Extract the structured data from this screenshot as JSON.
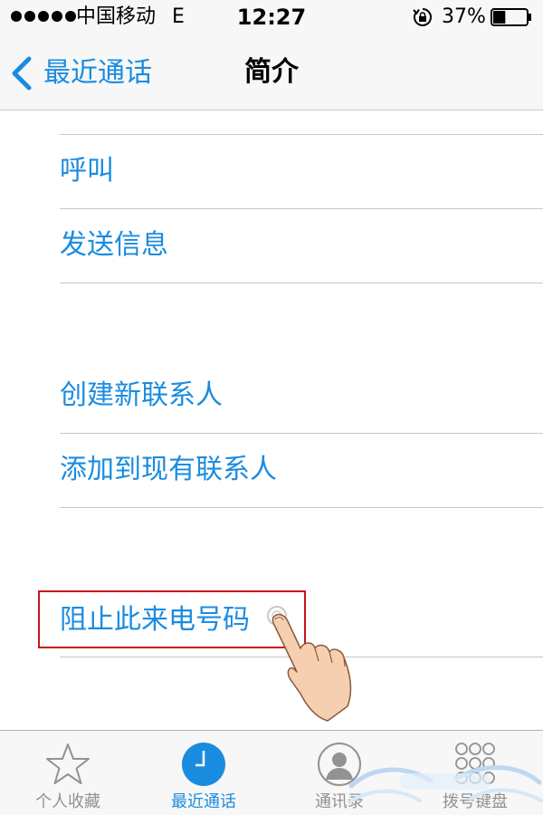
{
  "status_bar": {
    "carrier": "中国移动",
    "network": "E",
    "time": "12:27",
    "battery_percent": "37%",
    "battery_level": 0.37
  },
  "nav": {
    "back_label": "最近通话",
    "title": "简介"
  },
  "actions": {
    "call": "呼叫",
    "send_message": "发送信息",
    "create_contact": "创建新联系人",
    "add_to_existing": "添加到现有联系人",
    "block_caller": "阻止此来电号码"
  },
  "tabs": [
    {
      "label": "个人收藏",
      "icon": "star-icon",
      "active": false
    },
    {
      "label": "最近通话",
      "icon": "clock-icon",
      "active": true
    },
    {
      "label": "通讯录",
      "icon": "contact-icon",
      "active": false
    },
    {
      "label": "拨号键盘",
      "icon": "keypad-icon",
      "active": false
    }
  ],
  "colors": {
    "accent": "#1a8ce0",
    "highlight_border": "#c8141c",
    "inactive_tab": "#929292",
    "bar_background": "#f7f7f7"
  }
}
